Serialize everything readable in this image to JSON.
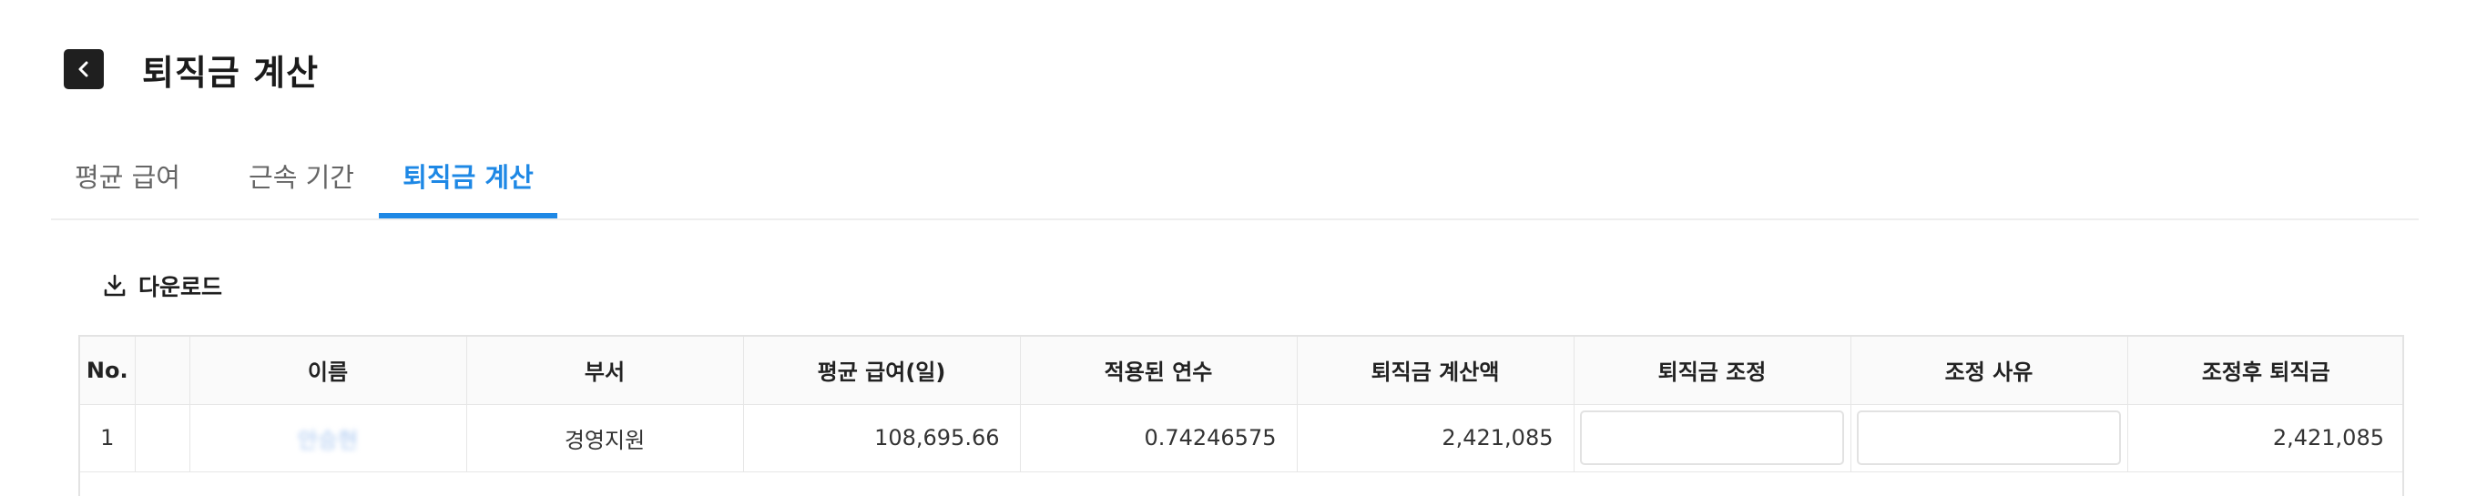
{
  "header": {
    "title": "퇴직금 계산",
    "back_icon": "chevron-left-icon"
  },
  "tabs": [
    {
      "label": "평균 급여",
      "active": false
    },
    {
      "label": "근속 기간",
      "active": false
    },
    {
      "label": "퇴직금 계산",
      "active": true
    }
  ],
  "toolbar": {
    "download_label": "다운로드",
    "download_icon": "download-icon"
  },
  "table": {
    "columns": [
      "No.",
      "",
      "이름",
      "부서",
      "평균 급여(일)",
      "적용된 연수",
      "퇴직금 계산액",
      "퇴직금 조정",
      "조정 사유",
      "조정후 퇴직금"
    ],
    "rows": [
      {
        "no": "1",
        "select": "",
        "name": "안승현",
        "department": "경영지원",
        "avg_daily_pay": "108,695.66",
        "applied_years": "0.74246575",
        "severance_calc": "2,421,085",
        "adjustment": "",
        "adjust_reason": "",
        "adjusted_severance": "2,421,085"
      }
    ]
  },
  "colors": {
    "accent": "#1e88e5",
    "back_button": "#1f1f1f",
    "header_bg": "#fafafa"
  }
}
